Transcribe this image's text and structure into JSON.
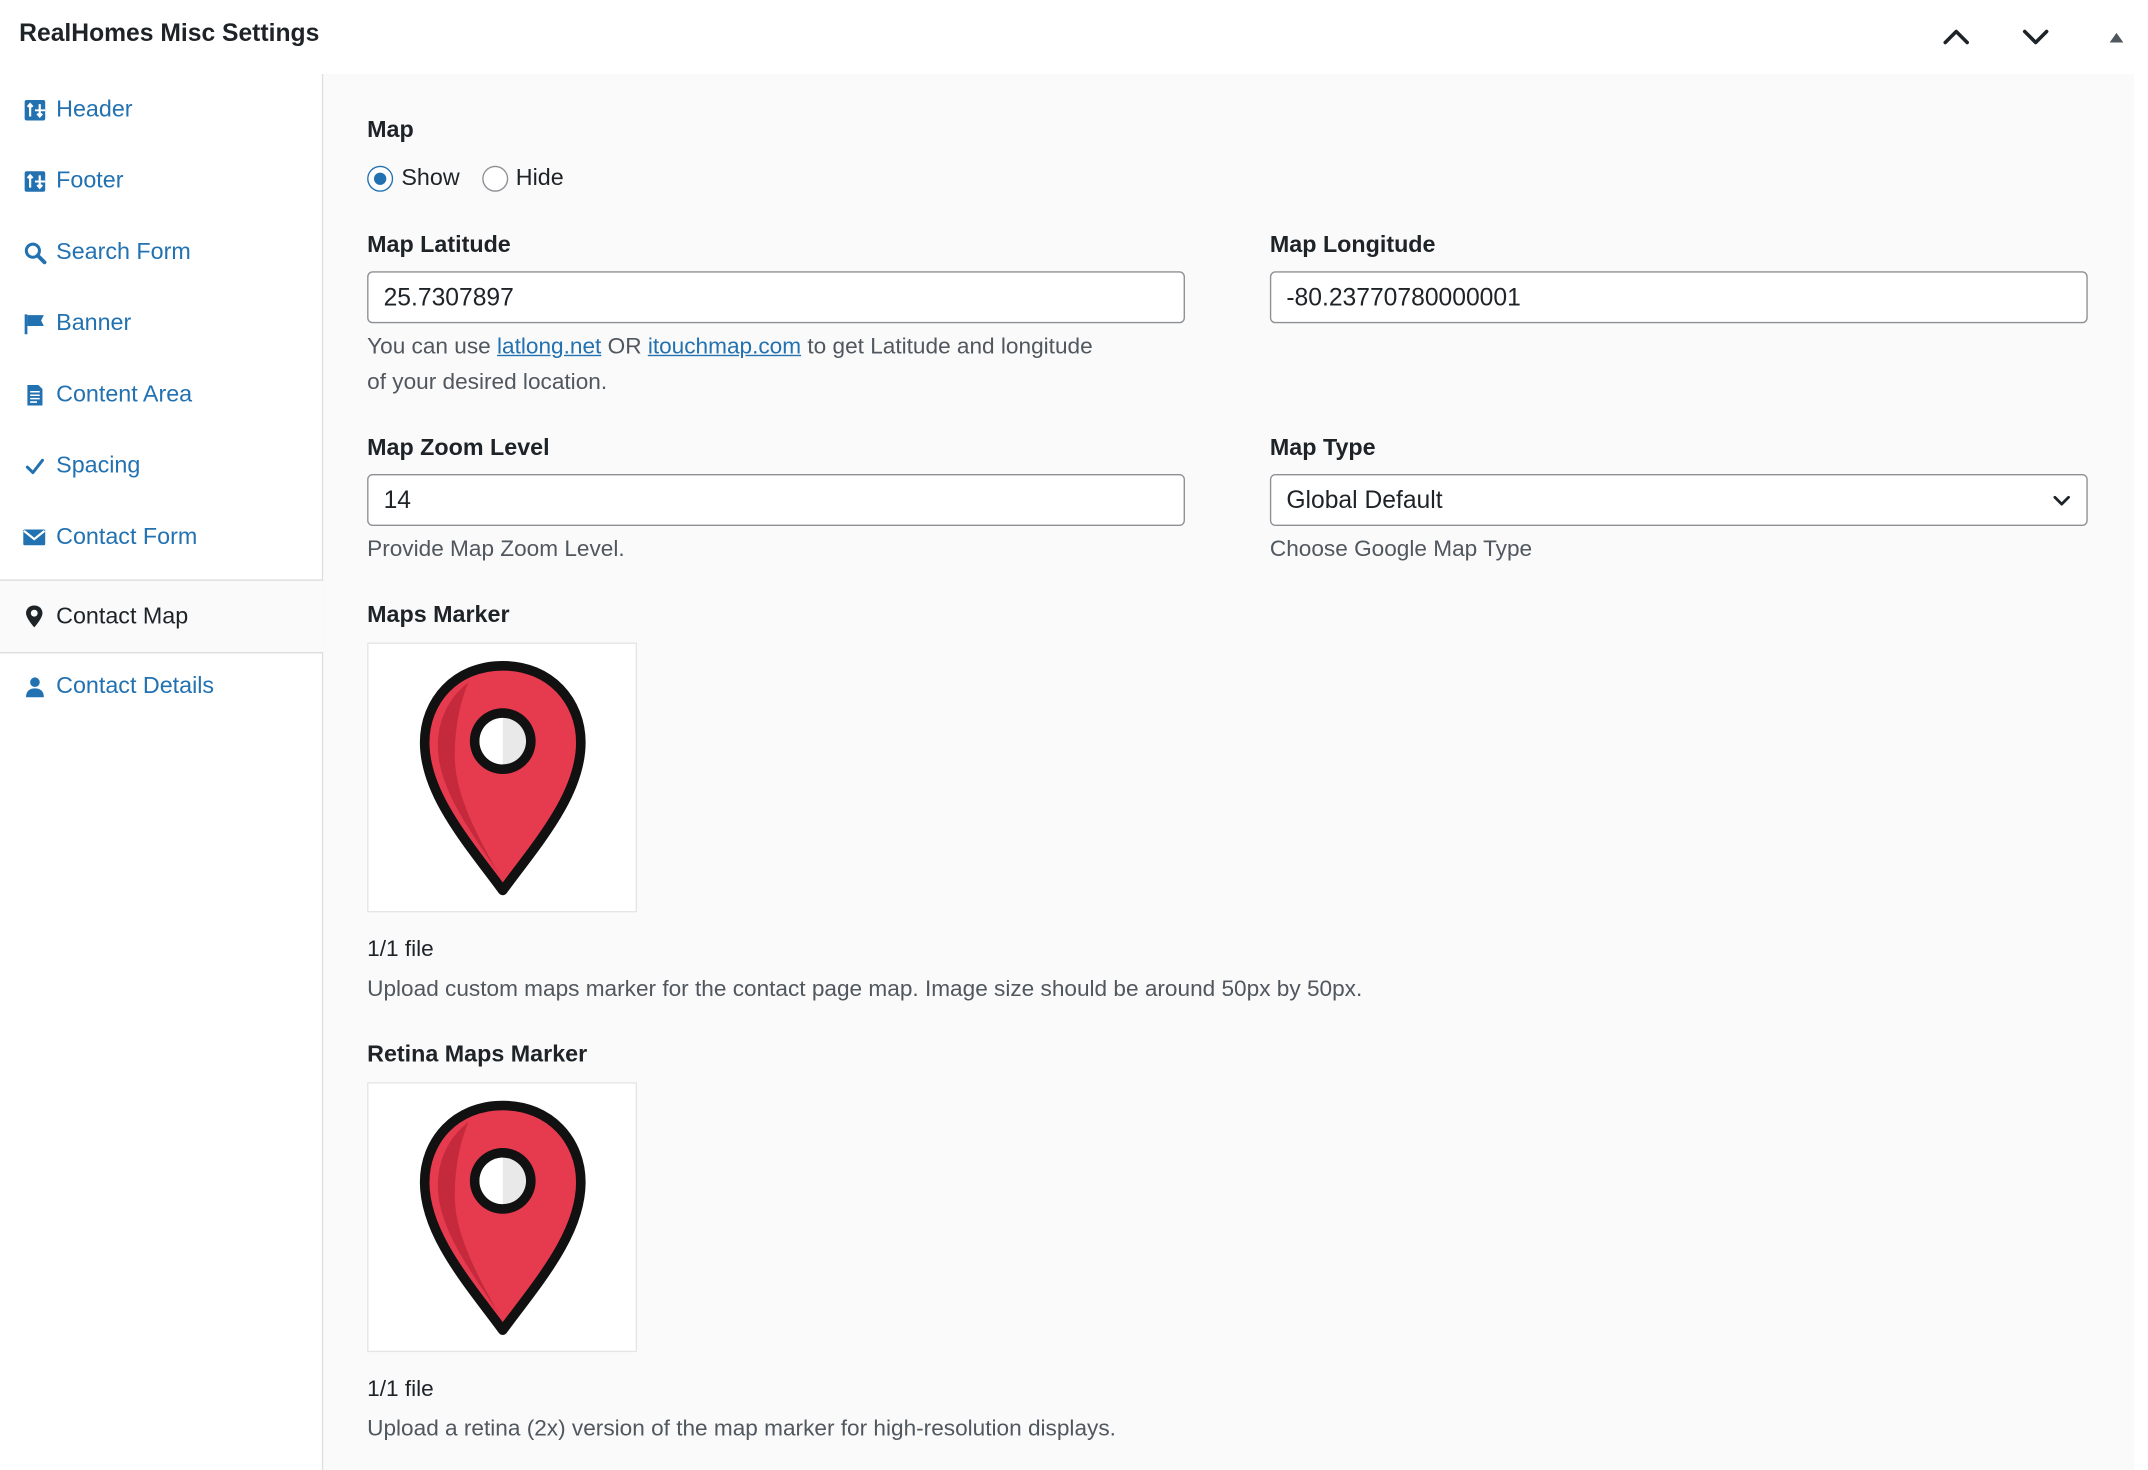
{
  "header": {
    "title": "RealHomes Misc Settings"
  },
  "sidebar": {
    "items": [
      {
        "label": "Header",
        "icon": "header-layout-icon"
      },
      {
        "label": "Footer",
        "icon": "footer-layout-icon"
      },
      {
        "label": "Search Form",
        "icon": "search-icon"
      },
      {
        "label": "Banner",
        "icon": "flag-icon"
      },
      {
        "label": "Content Area",
        "icon": "document-icon"
      },
      {
        "label": "Spacing",
        "icon": "checkmark-icon"
      },
      {
        "label": "Contact Form",
        "icon": "envelope-icon"
      },
      {
        "label": "Contact Map",
        "icon": "map-pin-icon",
        "active": true
      },
      {
        "label": "Contact Details",
        "icon": "person-icon"
      }
    ]
  },
  "map": {
    "label": "Map",
    "options": [
      "Show",
      "Hide"
    ],
    "selected": "Show"
  },
  "latitude": {
    "label": "Map Latitude",
    "value": "25.7307897",
    "desc_before": "You can use ",
    "link1": "latlong.net",
    "desc_mid": " OR ",
    "link2": "itouchmap.com",
    "desc_after": " to get Latitude and longitude",
    "desc_line2": "of your desired location."
  },
  "longitude": {
    "label": "Map Longitude",
    "value": "-80.23770780000001"
  },
  "zoom": {
    "label": "Map Zoom Level",
    "value": "14",
    "desc": "Provide Map Zoom Level."
  },
  "map_type": {
    "label": "Map Type",
    "value": "Global Default",
    "desc": "Choose Google Map Type"
  },
  "marker": {
    "label": "Maps Marker",
    "file_count": "1/1 file",
    "desc": "Upload custom maps marker for the contact page map. Image size should be around 50px by 50px."
  },
  "retina_marker": {
    "label": "Retina Maps Marker",
    "file_count": "1/1 file",
    "desc": "Upload a retina (2x) version of the map marker for high-resolution displays."
  },
  "colors": {
    "accent": "#2271b1",
    "pin_red": "#e63a4f",
    "pin_dark_red": "#c42a3c"
  }
}
